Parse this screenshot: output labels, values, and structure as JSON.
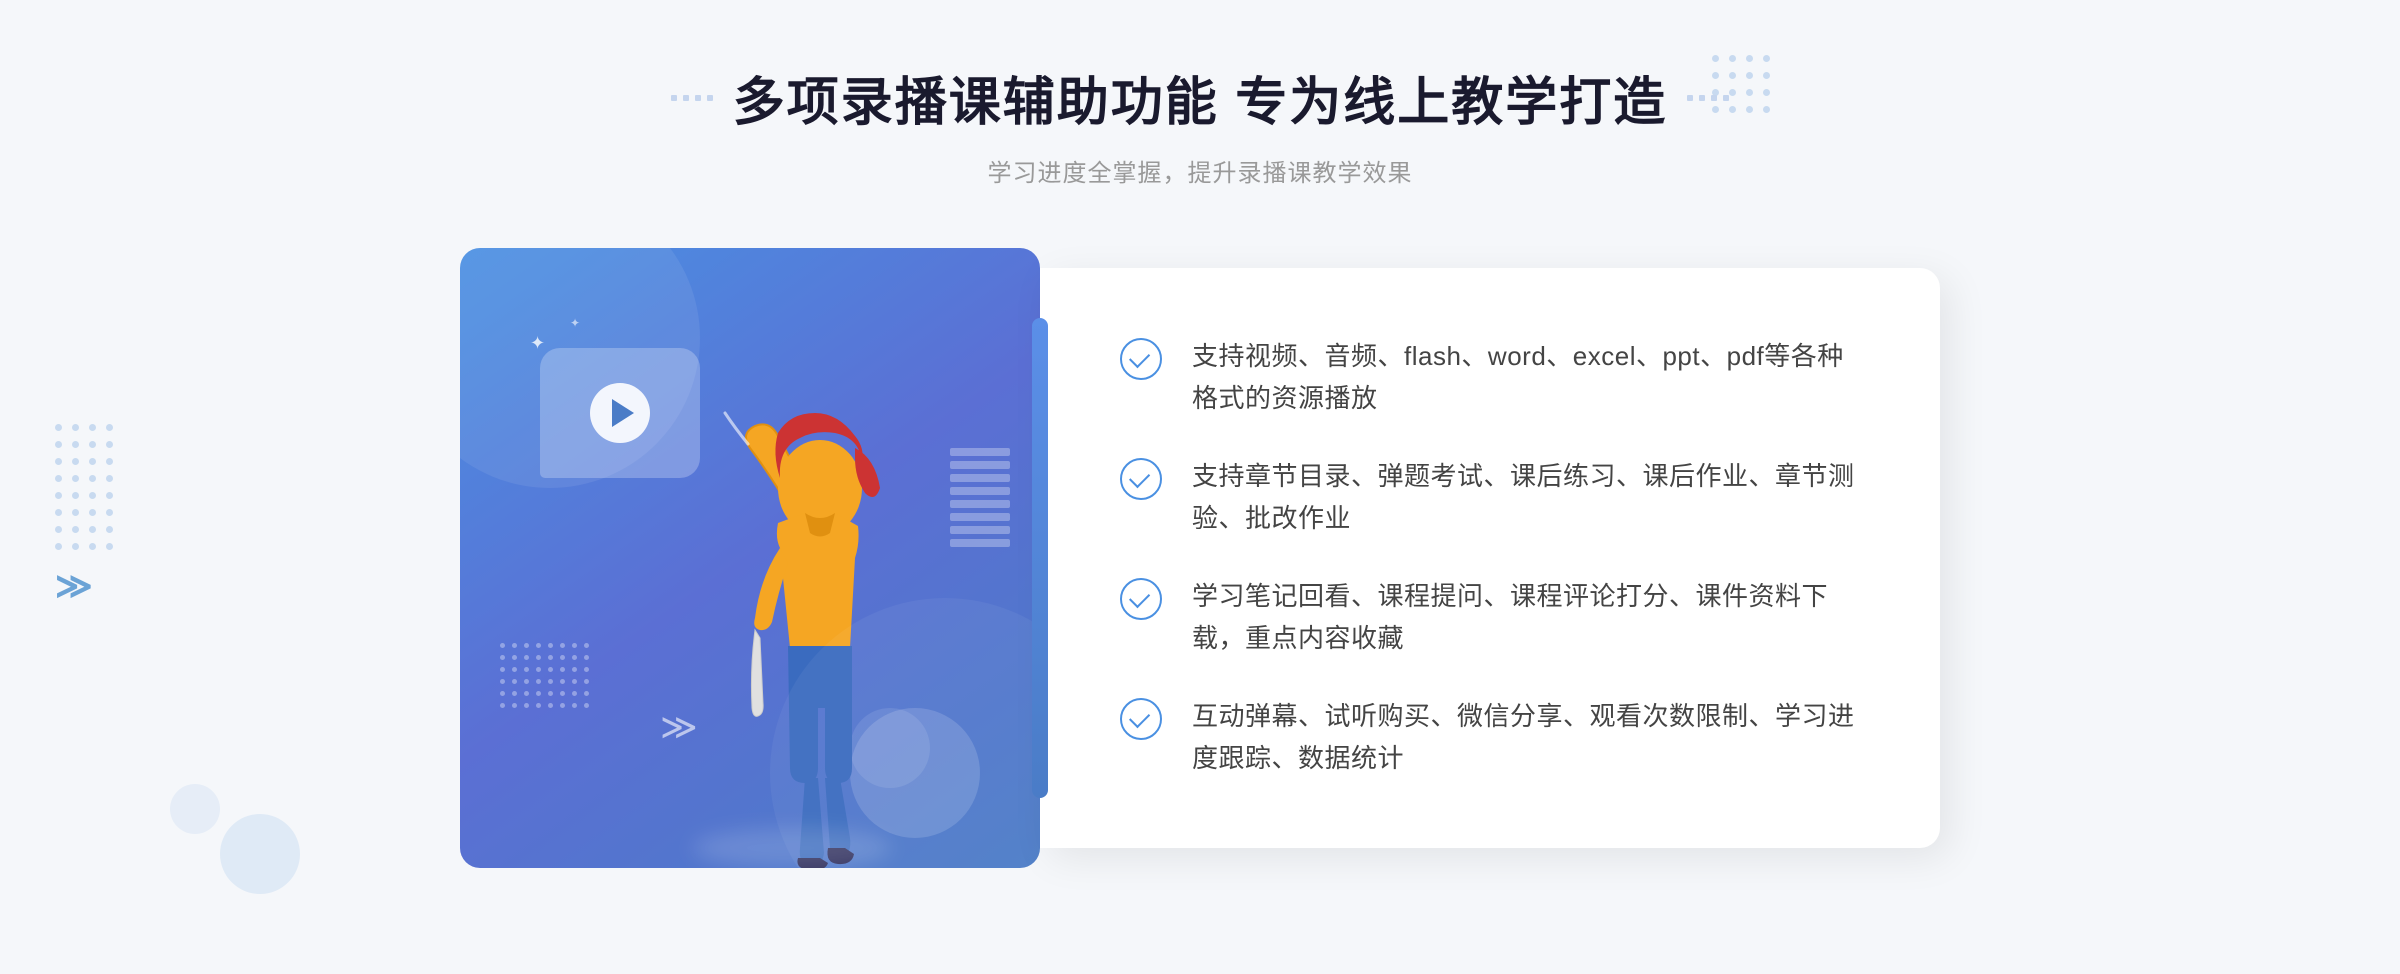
{
  "header": {
    "title": "多项录播课辅助功能 专为线上教学打造",
    "subtitle": "学习进度全掌握，提升录播课教学效果",
    "decorator_left": "❋ ❋",
    "decorator_right": "❋ ❋"
  },
  "features": [
    {
      "id": "feature-1",
      "text": "支持视频、音频、flash、word、excel、ppt、pdf等各种格式的资源播放"
    },
    {
      "id": "feature-2",
      "text": "支持章节目录、弹题考试、课后练习、课后作业、章节测验、批改作业"
    },
    {
      "id": "feature-3",
      "text": "学习笔记回看、课程提问、课程评论打分、课件资料下载，重点内容收藏"
    },
    {
      "id": "feature-4",
      "text": "互动弹幕、试听购买、微信分享、观看次数限制、学习进度跟踪、数据统计"
    }
  ],
  "colors": {
    "primary": "#4a90e2",
    "primary_dark": "#3a7bc8",
    "text_dark": "#1a1a2e",
    "text_gray": "#999999",
    "text_feature": "#444444",
    "bg": "#f5f7fa",
    "card_bg": "#ffffff"
  },
  "illustration": {
    "play_button_visible": true
  }
}
